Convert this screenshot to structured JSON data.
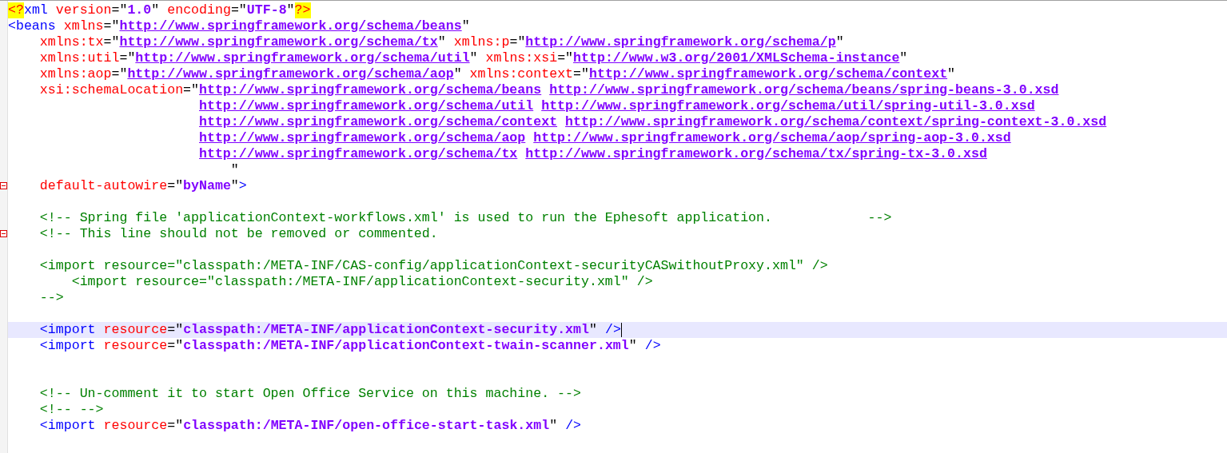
{
  "editor": {
    "lines": [
      {
        "current": false,
        "segments": [
          {
            "kind": "pi",
            "text": "<?"
          },
          {
            "kind": "tag",
            "text": "xml"
          },
          {
            "kind": "attr",
            "text": " version"
          },
          {
            "kind": "punct",
            "text": "=\""
          },
          {
            "kind": "value",
            "text": "1.0"
          },
          {
            "kind": "punct",
            "text": "\""
          },
          {
            "kind": "attr",
            "text": " encoding"
          },
          {
            "kind": "punct",
            "text": "=\""
          },
          {
            "kind": "value",
            "text": "UTF-8"
          },
          {
            "kind": "punct",
            "text": "\""
          },
          {
            "kind": "pi",
            "text": "?>"
          }
        ]
      },
      {
        "current": false,
        "segments": [
          {
            "kind": "tag",
            "text": "<beans"
          },
          {
            "kind": "attr",
            "text": " xmlns"
          },
          {
            "kind": "punct",
            "text": "=\""
          },
          {
            "kind": "url",
            "text": "http://www.springframework.org/schema/beans"
          },
          {
            "kind": "punct",
            "text": "\""
          }
        ]
      },
      {
        "current": false,
        "segments": [
          {
            "kind": "attr",
            "text": "    xmlns:tx"
          },
          {
            "kind": "punct",
            "text": "=\""
          },
          {
            "kind": "url",
            "text": "http://www.springframework.org/schema/tx"
          },
          {
            "kind": "punct",
            "text": "\""
          },
          {
            "kind": "attr",
            "text": " xmlns:p"
          },
          {
            "kind": "punct",
            "text": "=\""
          },
          {
            "kind": "url",
            "text": "http://www.springframework.org/schema/p"
          },
          {
            "kind": "punct",
            "text": "\""
          }
        ]
      },
      {
        "current": false,
        "segments": [
          {
            "kind": "attr",
            "text": "    xmlns:util"
          },
          {
            "kind": "punct",
            "text": "=\""
          },
          {
            "kind": "url",
            "text": "http://www.springframework.org/schema/util"
          },
          {
            "kind": "punct",
            "text": "\""
          },
          {
            "kind": "attr",
            "text": " xmlns:xsi"
          },
          {
            "kind": "punct",
            "text": "=\""
          },
          {
            "kind": "url",
            "text": "http://www.w3.org/2001/XMLSchema-instance"
          },
          {
            "kind": "punct",
            "text": "\""
          }
        ]
      },
      {
        "current": false,
        "segments": [
          {
            "kind": "attr",
            "text": "    xmlns:aop"
          },
          {
            "kind": "punct",
            "text": "=\""
          },
          {
            "kind": "url",
            "text": "http://www.springframework.org/schema/aop"
          },
          {
            "kind": "punct",
            "text": "\""
          },
          {
            "kind": "attr",
            "text": " xmlns:context"
          },
          {
            "kind": "punct",
            "text": "=\""
          },
          {
            "kind": "url",
            "text": "http://www.springframework.org/schema/context"
          },
          {
            "kind": "punct",
            "text": "\""
          }
        ]
      },
      {
        "current": false,
        "segments": [
          {
            "kind": "attr",
            "text": "    xsi:schemaLocation"
          },
          {
            "kind": "punct",
            "text": "=\""
          },
          {
            "kind": "url",
            "text": "http://www.springframework.org/schema/beans"
          },
          {
            "kind": "url",
            "text": " http://www.springframework.org/schema/beans/spring-beans-3.0.xsd"
          }
        ]
      },
      {
        "current": false,
        "segments": [
          {
            "kind": "url",
            "text": "                        http://www.springframework.org/schema/util"
          },
          {
            "kind": "url",
            "text": " http://www.springframework.org/schema/util/spring-util-3.0.xsd"
          }
        ]
      },
      {
        "current": false,
        "segments": [
          {
            "kind": "url",
            "text": "                        http://www.springframework.org/schema/context"
          },
          {
            "kind": "url",
            "text": " http://www.springframework.org/schema/context/spring-context-3.0.xsd"
          }
        ]
      },
      {
        "current": false,
        "segments": [
          {
            "kind": "url",
            "text": "                        http://www.springframework.org/schema/aop"
          },
          {
            "kind": "url",
            "text": " http://www.springframework.org/schema/aop/spring-aop-3.0.xsd"
          }
        ]
      },
      {
        "current": false,
        "segments": [
          {
            "kind": "url",
            "text": "                        http://www.springframework.org/schema/tx"
          },
          {
            "kind": "url",
            "text": " http://www.springframework.org/schema/tx/spring-tx-3.0.xsd"
          }
        ]
      },
      {
        "current": false,
        "segments": [
          {
            "kind": "punct",
            "text": "                            \""
          }
        ]
      },
      {
        "current": false,
        "fold": true,
        "segments": [
          {
            "kind": "attr",
            "text": "    default-autowire"
          },
          {
            "kind": "punct",
            "text": "=\""
          },
          {
            "kind": "value",
            "text": "byName"
          },
          {
            "kind": "punct",
            "text": "\""
          },
          {
            "kind": "tag",
            "text": ">"
          }
        ]
      },
      {
        "current": false
      },
      {
        "current": false,
        "segments": [
          {
            "kind": "comment",
            "text": "    <!-- Spring file 'applicationContext-workflows.xml' is used to run the Ephesoft application.            -->"
          }
        ]
      },
      {
        "current": false,
        "fold": true,
        "segments": [
          {
            "kind": "comment",
            "text": "    <!-- This line should not be removed or commented."
          }
        ]
      },
      {
        "current": false
      },
      {
        "current": false,
        "segments": [
          {
            "kind": "comment",
            "text": "    <import resource=\"classpath:/META-INF/CAS-config/applicationContext-securityCASwithoutProxy.xml\" />"
          }
        ]
      },
      {
        "current": false,
        "segments": [
          {
            "kind": "comment",
            "text": "        <import resource=\"classpath:/META-INF/applicationContext-security.xml\" />"
          }
        ]
      },
      {
        "current": false,
        "segments": [
          {
            "kind": "comment",
            "text": "    -->"
          }
        ]
      },
      {
        "current": false
      },
      {
        "current": true,
        "segments": [
          {
            "kind": "tag",
            "text": "    <import"
          },
          {
            "kind": "attr",
            "text": " resource"
          },
          {
            "kind": "punct",
            "text": "=\""
          },
          {
            "kind": "value",
            "text": "classpath:/META-INF/applicationContext-security.xml"
          },
          {
            "kind": "punct",
            "text": "\""
          },
          {
            "kind": "tag",
            "text": " />"
          }
        ]
      },
      {
        "current": false,
        "segments": [
          {
            "kind": "tag",
            "text": "    <import"
          },
          {
            "kind": "attr",
            "text": " resource"
          },
          {
            "kind": "punct",
            "text": "=\""
          },
          {
            "kind": "value",
            "text": "classpath:/META-INF/applicationContext-twain-scanner.xml"
          },
          {
            "kind": "punct",
            "text": "\""
          },
          {
            "kind": "tag",
            "text": " />"
          }
        ]
      },
      {
        "current": false
      },
      {
        "current": false
      },
      {
        "current": false,
        "segments": [
          {
            "kind": "comment",
            "text": "    <!-- Un-comment it to start Open Office Service on this machine. -->"
          }
        ]
      },
      {
        "current": false,
        "segments": [
          {
            "kind": "comment",
            "text": "    <!-- -->"
          }
        ]
      },
      {
        "current": false,
        "segments": [
          {
            "kind": "tag",
            "text": "    <import"
          },
          {
            "kind": "attr",
            "text": " resource"
          },
          {
            "kind": "punct",
            "text": "=\""
          },
          {
            "kind": "value",
            "text": "classpath:/META-INF/open-office-start-task.xml"
          },
          {
            "kind": "punct",
            "text": "\""
          },
          {
            "kind": "tag",
            "text": " />"
          }
        ]
      }
    ]
  }
}
